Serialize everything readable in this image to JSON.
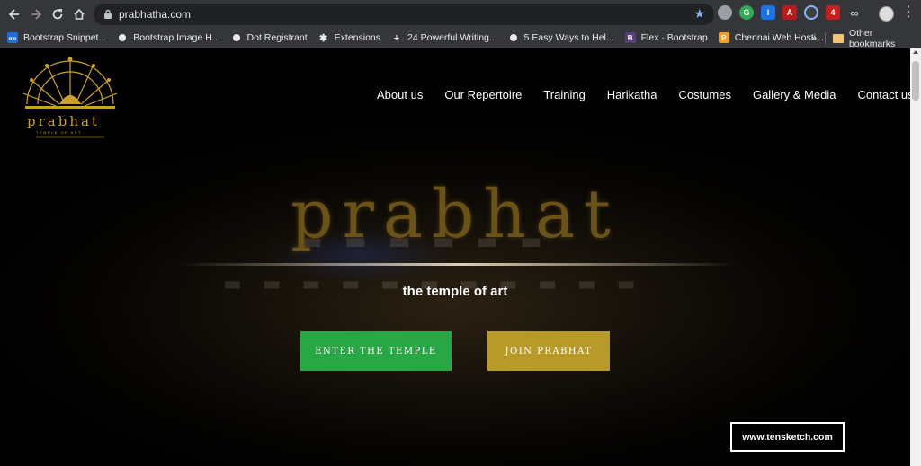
{
  "browser": {
    "url": "prabhatha.com",
    "bookmarks": [
      {
        "label": "Bootstrap Snippet...",
        "icon": "bootstrap-snippets-icon",
        "color": "#1e6fd9",
        "glyph": "«»"
      },
      {
        "label": "Bootstrap Image H...",
        "icon": "globe-icon",
        "color": "#e8eaed",
        "glyph": ""
      },
      {
        "label": "Dot Registrant",
        "icon": "globe-icon",
        "color": "#e8eaed",
        "glyph": ""
      },
      {
        "label": "Extensions",
        "icon": "puzzle-icon",
        "color": "#e8eaed",
        "glyph": ""
      },
      {
        "label": "24 Powerful Writing...",
        "icon": "writing-icon",
        "color": "#35363a",
        "glyph": "∔"
      },
      {
        "label": "5 Easy Ways to Hel...",
        "icon": "globe-icon",
        "color": "#e8eaed",
        "glyph": ""
      },
      {
        "label": "Flex · Bootstrap",
        "icon": "bootstrap-icon",
        "color": "#563d7c",
        "glyph": "B"
      },
      {
        "label": "Chennai Web Hosti...",
        "icon": "hosting-icon",
        "color": "#f0a020",
        "glyph": "P"
      }
    ],
    "more": "»",
    "other_bookmarks": "Other bookmarks"
  },
  "site": {
    "logo_word": "prabhat",
    "logo_tagline": "TEMPLE OF ART",
    "nav": [
      "About us",
      "Our Repertoire",
      "Training",
      "Harikatha",
      "Costumes",
      "Gallery & Media",
      "Contact us"
    ],
    "hero_title": "prabhat",
    "hero_subtitle": "the temple of art",
    "buttons": {
      "enter": "ENTER THE TEMPLE",
      "join": "JOIN PRABHAT"
    },
    "credit": "www.tensketch.com"
  },
  "colors": {
    "gold": "#c9a227",
    "green_button": "#28a745",
    "gold_button": "#b89a2a",
    "chrome": "#35363a"
  }
}
